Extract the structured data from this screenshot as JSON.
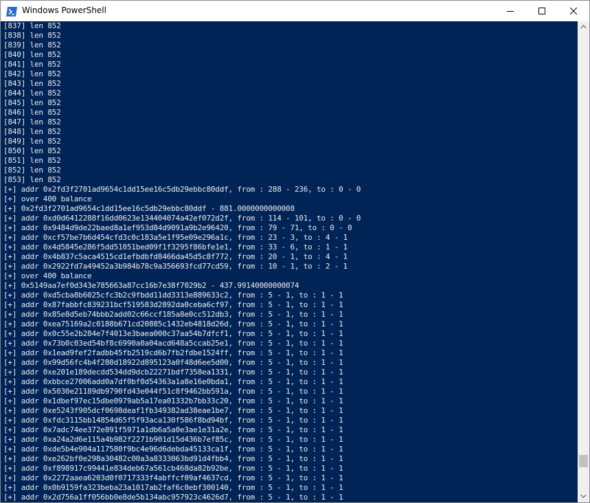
{
  "window": {
    "title": "Windows PowerShell",
    "icons": {
      "app": "powershell-icon",
      "minimize": "minimize-icon",
      "maximize": "maximize-icon",
      "close": "close-icon"
    }
  },
  "colors": {
    "console_bg": "#012456",
    "console_fg": "#eeedf0"
  },
  "console": {
    "lines": [
      "[837] len 852",
      "[838] len 852",
      "[839] len 852",
      "[840] len 852",
      "[841] len 852",
      "[842] len 852",
      "[843] len 852",
      "[844] len 852",
      "[845] len 852",
      "[846] len 852",
      "[847] len 852",
      "[848] len 852",
      "[849] len 852",
      "[850] len 852",
      "[851] len 852",
      "[852] len 852",
      "[853] len 852",
      "[+] addr 0x2fd3f2701ad9654c1dd15ee16c5db29ebbc80ddf, from : 288 - 236, to : 0 - 0",
      "[+] over 400 balance",
      "[+] 0x2fd3f2701ad9654c1dd15ee16c5db29ebbc80ddf - 881.0000000000008",
      "[+] addr 0xd0d6412288f16dd0623e134404074a42ef072d2f, from : 114 - 101, to : 0 - 0",
      "[+] addr 0x9484d9de22baed8a1ef953d84d9091a9b2e96420, from : 79 - 71, to : 0 - 0",
      "[+] addr 0xcf57be7b6d454cfd3c0c183a5e1f95e09e296a1c, from : 23 - 3, to : 4 - 1",
      "[+] addr 0x4d5845e286f5dd51051bed09f1f3295f86bfe1e1, from : 33 - 6, to : 1 - 1",
      "[+] addr 0x4b837c5aca4515cd1efbdbfd8466da45d5c8f772, from : 20 - 1, to : 4 - 1",
      "[+] addr 0x2922fd7a49452a3b984b78c9a356693fcd77cd59, from : 10 - 1, to : 2 - 1",
      "[+] over 400 balance",
      "[+] 0x5149aa7ef0d343e785663a87cc16b7e38f7029b2 - 437.99140000000074",
      "[+] addr 0xd5cba8b6025cfc3b2c9fbdd11dd3313e889633c2, from : 5 - 1, to : 1 - 1",
      "[+] addr 0x87fabbfc839231bcf519583d2892da0ceba6cf97, from : 5 - 1, to : 1 - 1",
      "[+] addr 0x85e8d5eb74bbb2add02c66ccf185a8e0cc512db3, from : 5 - 1, to : 1 - 1",
      "[+] addr 0xea75169a2c0188b671cd20885c1432eb4818d26d, from : 5 - 1, to : 1 - 1",
      "[+] addr 0x0c55e2b284e7f4013e3baea000c37aa54b7dfcf1, from : 5 - 1, to : 1 - 1",
      "[+] addr 0x73b0c03ed54bf8c6990a0a04acd648a5ccab25e1, from : 5 - 1, to : 1 - 1",
      "[+] addr 0x1ead9fef2fadbb45fb2519cd6b7fb2fdbe1524ff, from : 5 - 1, to : 1 - 1",
      "[+] addr 0x99d56fc4b4f280d18922d895123a0f48d6ee5d00, from : 5 - 1, to : 1 - 1",
      "[+] addr 0xe201e189decdd534dd9dcb22271bdf7358ea1331, from : 5 - 1, to : 1 - 1",
      "[+] addr 0xbbce27006add0a7df0bf0d54363a1a8e16e0bda1, from : 5 - 1, to : 1 - 1",
      "[+] addr 0x5030e21189db9790fd43e044f51c8f9462bb591a, from : 5 - 1, to : 1 - 1",
      "[+] addr 0x1dbef97ec15dbe0979ab5a17ea01332b7bb33c20, from : 5 - 1, to : 1 - 1",
      "[+] addr 0xe5243f905dcf0698deaf1fb349382ad38eae1be7, from : 5 - 1, to : 1 - 1",
      "[+] addr 0xfdc3115bb14854d65f5f93aca130f586f8bd94bf, from : 5 - 1, to : 1 - 1",
      "[+] addr 0x7adc74ee372e891f5971a1db6a5a0e3ae1e31a2e, from : 5 - 1, to : 1 - 1",
      "[+] addr 0xa24a2d6e115a4b982f2271b901d15d436b7ef85c, from : 5 - 1, to : 1 - 1",
      "[+] addr 0xde5b4e904a117580f9bc4e96d6debda45133ca1f, from : 5 - 1, to : 1 - 1",
      "[+] addr 0xe262bf0e298a30482c00a3a8333063bd91d4fbb4, from : 5 - 1, to : 1 - 1",
      "[+] addr 0xf898917c99441e834deb67a561cb468da82b92be, from : 5 - 1, to : 1 - 1",
      "[+] addr 0x2272aaea6203d0f0717333f4abffcf09af4637cd, from : 5 - 1, to : 1 - 1",
      "[+] addr 0x0b9159fa323beba23a1017ab2faf6c0ebf300140, from : 5 - 1, to : 1 - 1",
      "[+] addr 0x2d756a1ff056bb0e8de5b134abc957923c4626d7, from : 5 - 1, to : 1 - 1"
    ]
  },
  "scroll": {
    "position_fraction": 0.95
  }
}
